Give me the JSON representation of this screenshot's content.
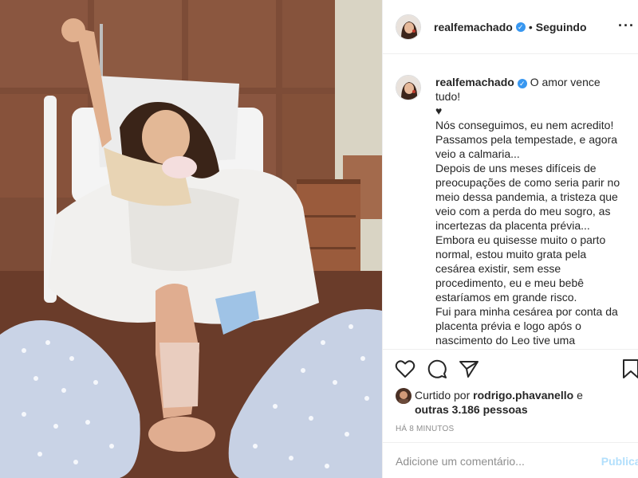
{
  "photo": {
    "alt": ""
  },
  "header": {
    "username": "realfemachado",
    "verified": true,
    "separator": "•",
    "follow_label": "Seguindo",
    "more_icon": "more-horizontal-icon"
  },
  "caption": {
    "username": "realfemachado",
    "first_line": "O amor vence tudo!",
    "lines": [
      "♥",
      "Nós conseguimos, eu nem acredito!",
      "Passamos pela tempestade, e agora veio a calmaria...",
      "Depois de uns meses difíceis de preocupações de como seria parir no meio dessa pandemia, a tristeza que veio com a perda do meu sogro, as incertezas da placenta prévia... Embora eu quisesse muito o parto normal, estou muito grata pela cesárea existir, sem esse procedimento, eu e meu bebê estaríamos em grande risco.",
      "Fui para minha cesárea por conta da placenta prévia e logo após o nascimento do Leo tive uma hemorragia, a médica descobriu que minha placenta além de prévia era"
    ]
  },
  "actions": {
    "like_icon": "heart-icon",
    "comment_icon": "comment-icon",
    "share_icon": "share-icon",
    "save_icon": "bookmark-icon"
  },
  "likes": {
    "prefix": "Curtido por",
    "user": "rodrigo.phavanello",
    "conj": "e",
    "others": "outras 3.186 pessoas"
  },
  "timestamp": "HÁ 8 MINUTOS",
  "comment": {
    "placeholder": "Adicione um comentário...",
    "post_label": "Publicar"
  },
  "colors": {
    "verified": "#3897f0",
    "publish_disabled": "#b2dffc",
    "muted": "#8e8e8e"
  }
}
